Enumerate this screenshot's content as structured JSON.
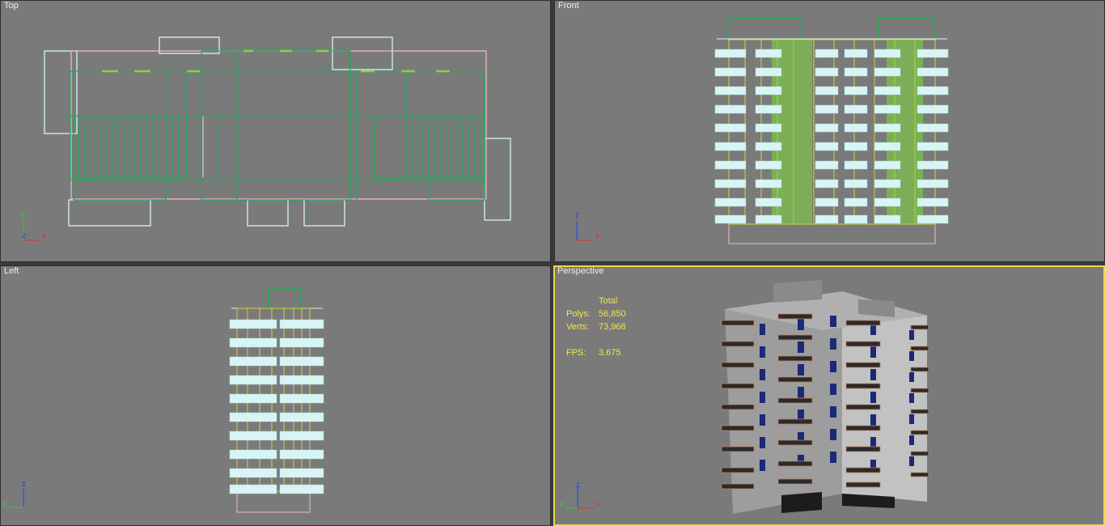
{
  "viewports": {
    "top": {
      "label": "Top"
    },
    "front": {
      "label": "Front"
    },
    "left": {
      "label": "Left"
    },
    "perspective": {
      "label": "Perspective"
    }
  },
  "stats": {
    "header": "Total",
    "polys_label": "Polys:",
    "polys_value": "56,850",
    "verts_label": "Verts:",
    "verts_value": "73,968",
    "fps_label": "FPS:",
    "fps_value": "3.675"
  },
  "axes": {
    "x": "x",
    "y": "y",
    "z": "z"
  },
  "colors": {
    "viewport_bg": "#7a7a7a",
    "active_border": "#e8d84a",
    "wire_green": "#1faa5a",
    "wire_cyan": "#d8f4f4",
    "wire_pink": "#f0b8c0",
    "wire_yellow": "#d8d040",
    "wire_lime": "#7ed83a",
    "stats_text": "#f2e64a"
  }
}
